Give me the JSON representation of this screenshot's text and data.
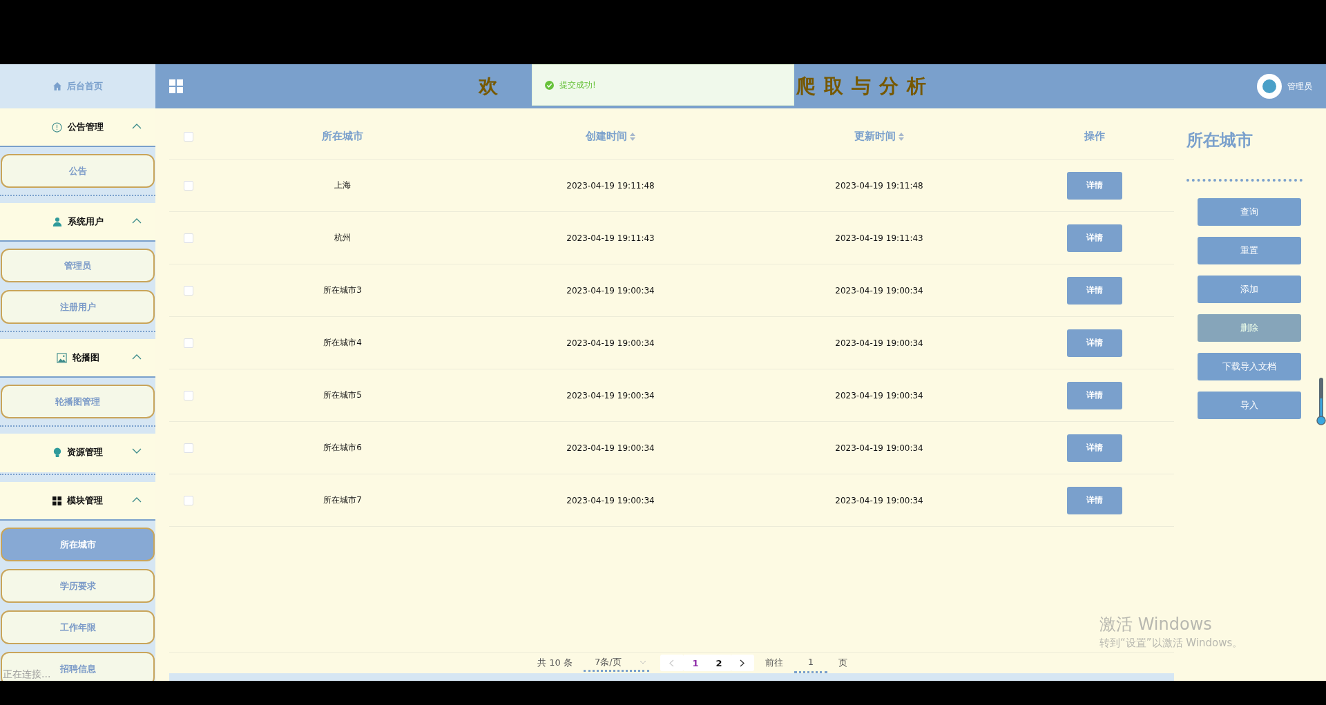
{
  "header": {
    "title_left": "欢",
    "title_right": "爬取与分析",
    "user": "管理员"
  },
  "toast": {
    "text": "提交成功!"
  },
  "sidebar": {
    "home": "后台首页",
    "groups": [
      {
        "label": "公告管理",
        "kind": "info",
        "expanded": true,
        "items": [
          {
            "label": "公告",
            "selected": false
          }
        ]
      },
      {
        "label": "系统用户",
        "kind": "user",
        "expanded": true,
        "items": [
          {
            "label": "管理员",
            "selected": false
          },
          {
            "label": "注册用户",
            "selected": false
          }
        ]
      },
      {
        "label": "轮播图",
        "kind": "image",
        "expanded": true,
        "items": [
          {
            "label": "轮播图管理",
            "selected": false
          }
        ]
      },
      {
        "label": "资源管理",
        "kind": "bulb",
        "expanded": false
      },
      {
        "label": "模块管理",
        "kind": "grid",
        "expanded": true,
        "items": [
          {
            "label": "所在城市",
            "selected": true
          },
          {
            "label": "学历要求",
            "selected": false
          },
          {
            "label": "工作年限",
            "selected": false
          },
          {
            "label": "招聘信息",
            "selected": false
          }
        ]
      }
    ]
  },
  "table": {
    "all_checked": false,
    "columns": [
      {
        "label": "所在城市",
        "sortable": false
      },
      {
        "label": "创建时间",
        "sortable": true
      },
      {
        "label": "更新时间",
        "sortable": true
      },
      {
        "label": "操作",
        "sortable": false
      }
    ],
    "rows": [
      {
        "checked": false,
        "city": "上海",
        "created": "2023-04-19 19:11:48",
        "updated": "2023-04-19 19:11:48",
        "action": "详情"
      },
      {
        "checked": false,
        "city": "杭州",
        "created": "2023-04-19 19:11:43",
        "updated": "2023-04-19 19:11:43",
        "action": "详情"
      },
      {
        "checked": false,
        "city": "所在城市3",
        "created": "2023-04-19 19:00:34",
        "updated": "2023-04-19 19:00:34",
        "action": "详情"
      },
      {
        "checked": false,
        "city": "所在城市4",
        "created": "2023-04-19 19:00:34",
        "updated": "2023-04-19 19:00:34",
        "action": "详情"
      },
      {
        "checked": false,
        "city": "所在城市5",
        "created": "2023-04-19 19:00:34",
        "updated": "2023-04-19 19:00:34",
        "action": "详情"
      },
      {
        "checked": false,
        "city": "所在城市6",
        "created": "2023-04-19 19:00:34",
        "updated": "2023-04-19 19:00:34",
        "action": "详情"
      },
      {
        "checked": false,
        "city": "所在城市7",
        "created": "2023-04-19 19:00:34",
        "updated": "2023-04-19 19:00:34",
        "action": "详情"
      }
    ]
  },
  "panel": {
    "title": "所在城市",
    "buttons": [
      {
        "label": "查询",
        "disabled": false
      },
      {
        "label": "重置",
        "disabled": false
      },
      {
        "label": "添加",
        "disabled": false
      },
      {
        "label": "删除",
        "disabled": true
      },
      {
        "label": "下载导入文档",
        "disabled": false
      },
      {
        "label": "导入",
        "disabled": false
      }
    ]
  },
  "pagination": {
    "total": "共 10 条",
    "page_size": "7条/页",
    "pages": [
      {
        "label": "1",
        "selected": true
      },
      {
        "label": "2",
        "selected": false
      }
    ],
    "goto_label": "前往",
    "goto_value": "1",
    "goto_suffix": "页"
  },
  "status_text": "正在连接...",
  "activation": {
    "title": "激活 Windows",
    "subtitle": "转到“设置”以激活 Windows。"
  }
}
